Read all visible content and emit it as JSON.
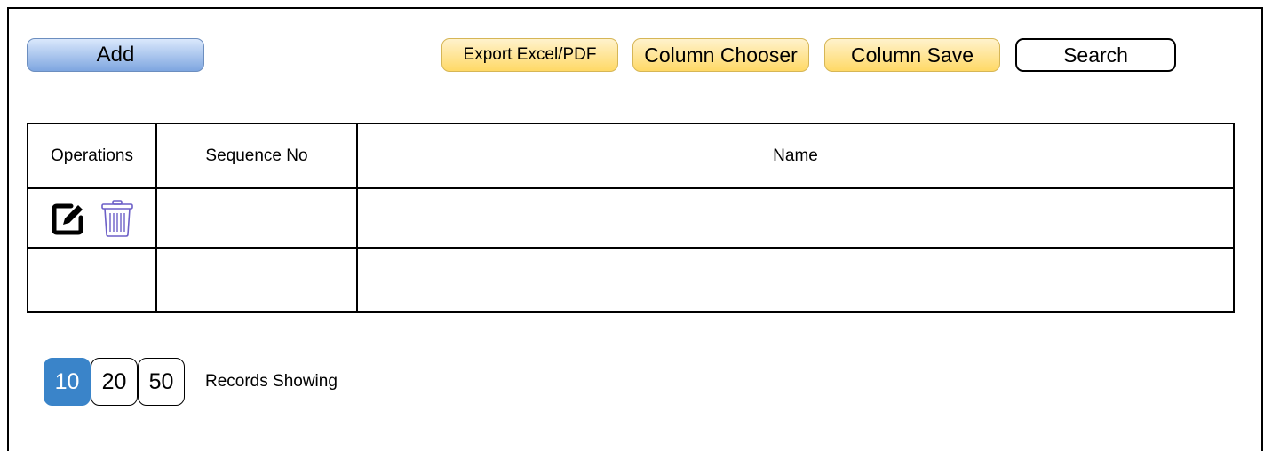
{
  "toolbar": {
    "add_label": "Add",
    "export_label": "Export Excel/PDF",
    "column_chooser_label": "Column Chooser",
    "column_save_label": "Column Save",
    "search_label": "Search"
  },
  "table": {
    "columns": [
      "Operations",
      "Sequence No",
      "Name"
    ],
    "rows": [
      {
        "operations": [
          "edit-icon",
          "trash-icon"
        ],
        "sequence_no": "",
        "name": ""
      },
      {
        "operations": [],
        "sequence_no": "",
        "name": ""
      }
    ]
  },
  "pager": {
    "page_sizes": [
      "10",
      "20",
      "50"
    ],
    "selected": "10",
    "label": "Records Showing"
  },
  "colors": {
    "add_button": "#7ea6e0",
    "yellow_button": "#ffd966",
    "active_page": "#3a84c9",
    "trash_icon": "#6c5fc7"
  }
}
